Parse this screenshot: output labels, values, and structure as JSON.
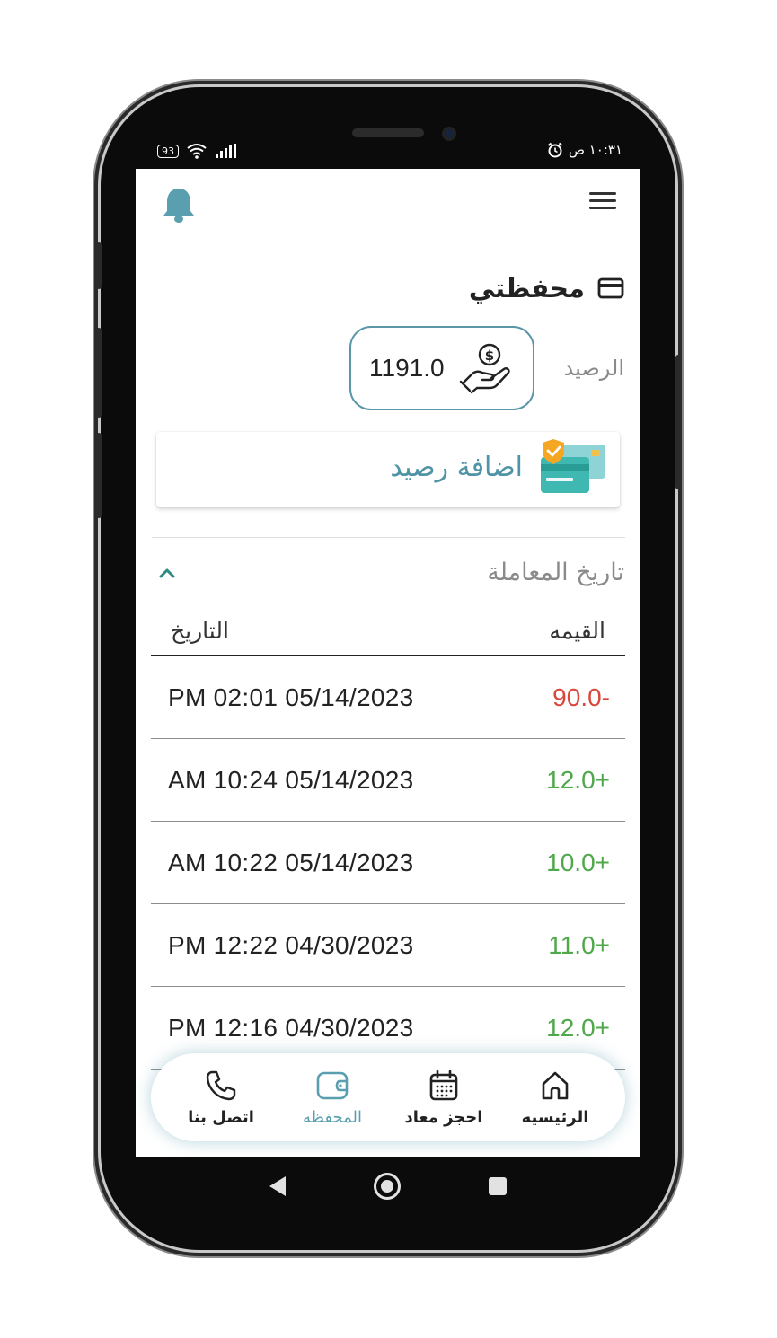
{
  "status_bar": {
    "battery": "93",
    "time": "١٠:٣١ ص"
  },
  "header": {
    "title": "محفظتي"
  },
  "balance": {
    "label": "الرصيد",
    "value": "1191.0"
  },
  "add_balance": {
    "label": "اضافة رصيد"
  },
  "history": {
    "title": "تاريخ المعاملة",
    "columns": {
      "value": "القيمه",
      "date": "التاريخ"
    },
    "rows": [
      {
        "date": "PM 02:01 05/14/2023",
        "amount": "90.0-",
        "type": "negative"
      },
      {
        "date": "AM 10:24 05/14/2023",
        "amount": "12.0+",
        "type": "positive"
      },
      {
        "date": "AM 10:22 05/14/2023",
        "amount": "10.0+",
        "type": "positive"
      },
      {
        "date": "PM 12:22 04/30/2023",
        "amount": "11.0+",
        "type": "positive"
      },
      {
        "date": "PM 12:16 04/30/2023",
        "amount": "12.0+",
        "type": "positive"
      }
    ]
  },
  "bottom_nav": {
    "home": "الرئيسيه",
    "book": "احجز معاد",
    "wallet": "المحفظه",
    "contact": "اتصل بنا"
  },
  "colors": {
    "accent": "#5a9fb0",
    "negative": "#d9463b",
    "positive": "#4fa84a"
  }
}
